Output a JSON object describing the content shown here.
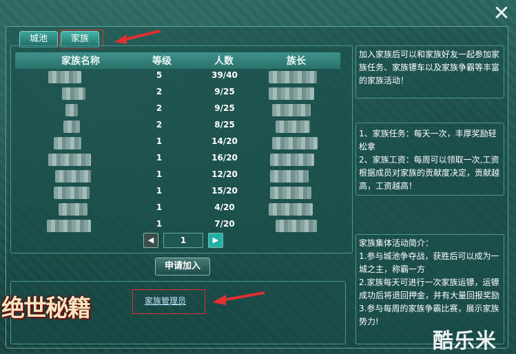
{
  "tabs": [
    {
      "label": "城池"
    },
    {
      "label": "家族"
    }
  ],
  "table": {
    "headers": [
      "家族名称",
      "等级",
      "人数",
      "族长"
    ],
    "rows": [
      {
        "level": "5",
        "members": "39/40"
      },
      {
        "level": "2",
        "members": "9/25"
      },
      {
        "level": "2",
        "members": "9/25"
      },
      {
        "level": "2",
        "members": "8/25"
      },
      {
        "level": "1",
        "members": "14/20"
      },
      {
        "level": "1",
        "members": "16/20"
      },
      {
        "level": "1",
        "members": "12/20"
      },
      {
        "level": "1",
        "members": "15/20"
      },
      {
        "level": "1",
        "members": "4/20"
      },
      {
        "level": "1",
        "members": "7/20"
      }
    ]
  },
  "pager": {
    "page": "1",
    "prev_icon": "left-arrow",
    "next_icon": "right-arrow"
  },
  "apply_button": "申请加入",
  "manager_link": "家族管理员",
  "right_panel": {
    "intro": "加入家族后可以和家族好友一起参加家族任务、家族镖车以及家族争霸等丰富的家族活动！",
    "task": "1、家族任务：每天一次，丰厚奖励轻松拿",
    "salary": "2、家族工资：每周可以领取一次,工资根据成员对家族的贡献度决定，贡献越高，工资越高！",
    "activity_title": "家族集体活动简介：",
    "activity_1": "1.参与城池争夺战，获胜后可以成为一城之主，称霸一方",
    "activity_2": "2.家族每天可进行一次家族运镖，运镖成功后将退回押金，并有大量回报奖励",
    "activity_3": "3.参与每周的家族争霸比赛，展示家族势力!"
  },
  "logo_text": "绝世秘籍",
  "watermark_text": "酷乐米",
  "colors": {
    "accent": "#3fa59b",
    "highlight": "#e03030",
    "link": "#c6e4ff"
  }
}
